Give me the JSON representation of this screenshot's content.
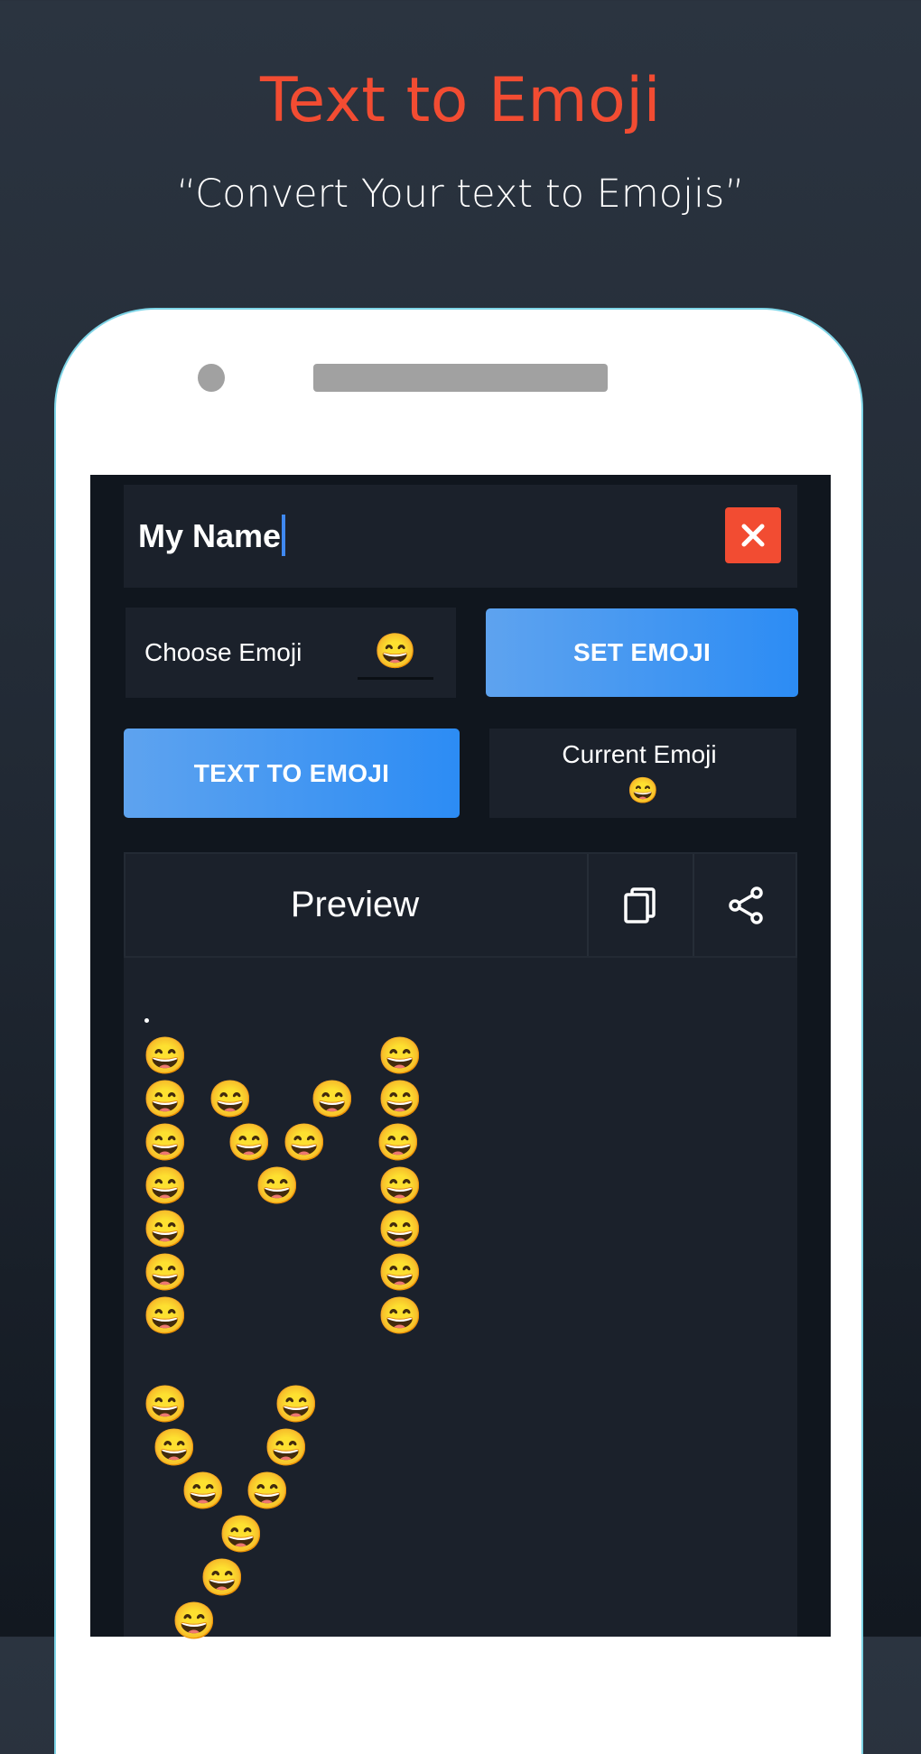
{
  "hero": {
    "title": "Text to Emoji",
    "subtitle": "“Convert Your text to Emojis”",
    "title_color": "#f24c32"
  },
  "app": {
    "input": {
      "value": "My Name",
      "clear_icon": "close-icon"
    },
    "choose_emoji": {
      "label": "Choose Emoji",
      "selected": "😄"
    },
    "buttons": {
      "set_emoji": "SET EMOJI",
      "text_to_emoji": "TEXT TO EMOJI"
    },
    "current_emoji": {
      "label": "Current Emoji",
      "value": "😄"
    },
    "preview": {
      "title": "Preview",
      "copy_icon": "copy-icon",
      "share_icon": "share-icon",
      "leading_text": ".",
      "emoji": "😄",
      "letters": [
        {
          "letter": "M",
          "rows": [
            [
              [
                0,
                0
              ],
              [
                1,
                0
              ]
            ],
            [
              [
                0,
                0
              ],
              [
                0,
                1
              ],
              [
                0,
                2
              ],
              [
                1,
                0
              ]
            ],
            [
              [
                0,
                0
              ],
              [
                0,
                1
              ],
              [
                0,
                2
              ],
              [
                1,
                0
              ]
            ],
            [
              [
                0,
                0
              ],
              [
                0,
                1
              ],
              [
                1,
                0
              ]
            ],
            [
              [
                0,
                0
              ],
              [
                1,
                0
              ]
            ],
            [
              [
                0,
                0
              ],
              [
                1,
                0
              ]
            ],
            [
              [
                0,
                0
              ],
              [
                1,
                0
              ]
            ]
          ]
        },
        {
          "letter": "Y",
          "rows": 6
        }
      ]
    }
  },
  "colors": {
    "accent_red": "#f24c32",
    "button_blue_start": "#5ea3ef",
    "button_blue_end": "#2c8cf4",
    "caret": "#3f88f0",
    "panel": "#1b212b",
    "screen_bg": "#10161e"
  }
}
